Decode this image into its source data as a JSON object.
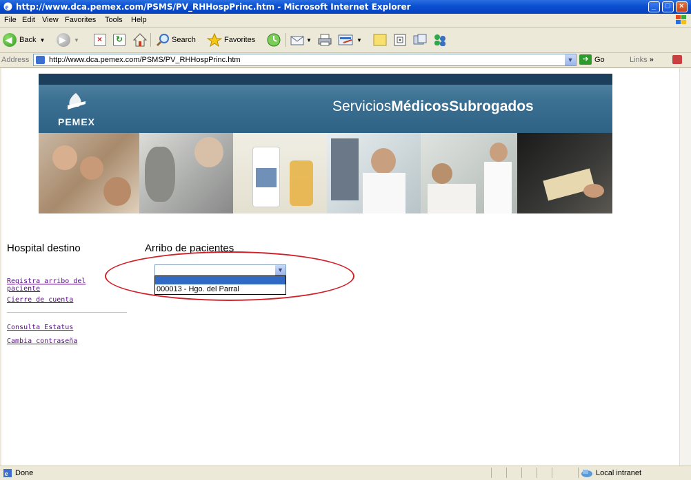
{
  "window": {
    "title": "http://www.dca.pemex.com/PSMS/PV_RHHospPrinc.htm - Microsoft Internet Explorer"
  },
  "menu": {
    "items": [
      "File",
      "Edit",
      "View",
      "Favorites",
      "Tools",
      "Help"
    ]
  },
  "toolbar": {
    "back_label": "Back",
    "search_label": "Search",
    "favorites_label": "Favorites"
  },
  "address": {
    "label": "Address",
    "url": "http://www.dca.pemex.com/PSMS/PV_RHHospPrinc.htm",
    "go_label": "Go",
    "links_label": "Links"
  },
  "banner": {
    "brand": "PEMEX",
    "title_regular": "Servicios",
    "title_bold1": "Médicos",
    "title_bold2": "Subrogados"
  },
  "page": {
    "left_heading": "Hospital destino",
    "main_heading": "Arribo de pacientes",
    "nav_links": [
      "Registra arribo del",
      "paciente",
      "Cierre de cuenta",
      "Consulta Estatus",
      "Cambia contraseña"
    ],
    "select": {
      "selected_value": "",
      "options": [
        "000013 - Hgo. del Parral"
      ]
    }
  },
  "status": {
    "text": "Done",
    "zone": "Local intranet"
  },
  "colors": {
    "titlebar": "#0a4fd0",
    "banner": "#3c7193",
    "link": "#5a0a88",
    "annotation": "#d0202a",
    "selection": "#316ac5"
  }
}
